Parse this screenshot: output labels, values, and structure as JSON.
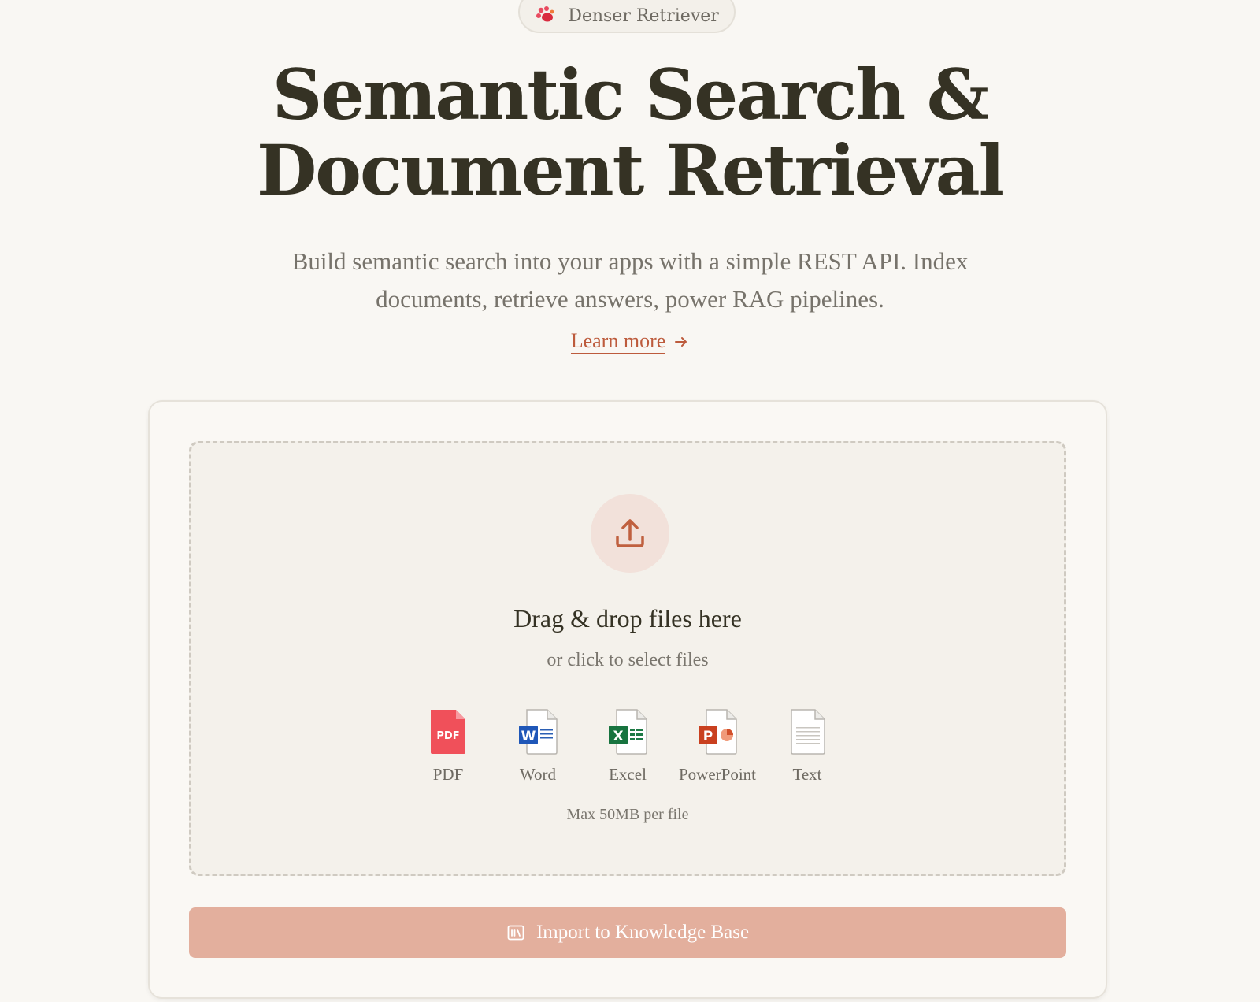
{
  "badge": {
    "label": "Denser Retriever",
    "logo_icon": "paw-logo-icon"
  },
  "hero": {
    "title_line1": "Semantic Search &",
    "title_line2": "Document Retrieval",
    "subtitle": "Build semantic search into your apps with a simple REST API. Index documents, retrieve answers, power RAG pipelines.",
    "learn_more": "Learn more",
    "learn_more_icon": "arrow-right-icon"
  },
  "upload": {
    "icon": "upload-icon",
    "title": "Drag & drop files here",
    "subtitle": "or click to select files",
    "file_types": [
      {
        "label": "PDF",
        "icon": "pdf-file-icon"
      },
      {
        "label": "Word",
        "icon": "word-file-icon"
      },
      {
        "label": "Excel",
        "icon": "excel-file-icon"
      },
      {
        "label": "PowerPoint",
        "icon": "powerpoint-file-icon"
      },
      {
        "label": "Text",
        "icon": "text-file-icon"
      }
    ],
    "max_size": "Max 50MB per file"
  },
  "import_button": {
    "label": "Import to Knowledge Base",
    "icon": "library-icon"
  },
  "colors": {
    "accent": "#bd5b3c",
    "button_bg": "#e3af9d",
    "background": "#f9f7f3",
    "title_text": "#353224"
  }
}
